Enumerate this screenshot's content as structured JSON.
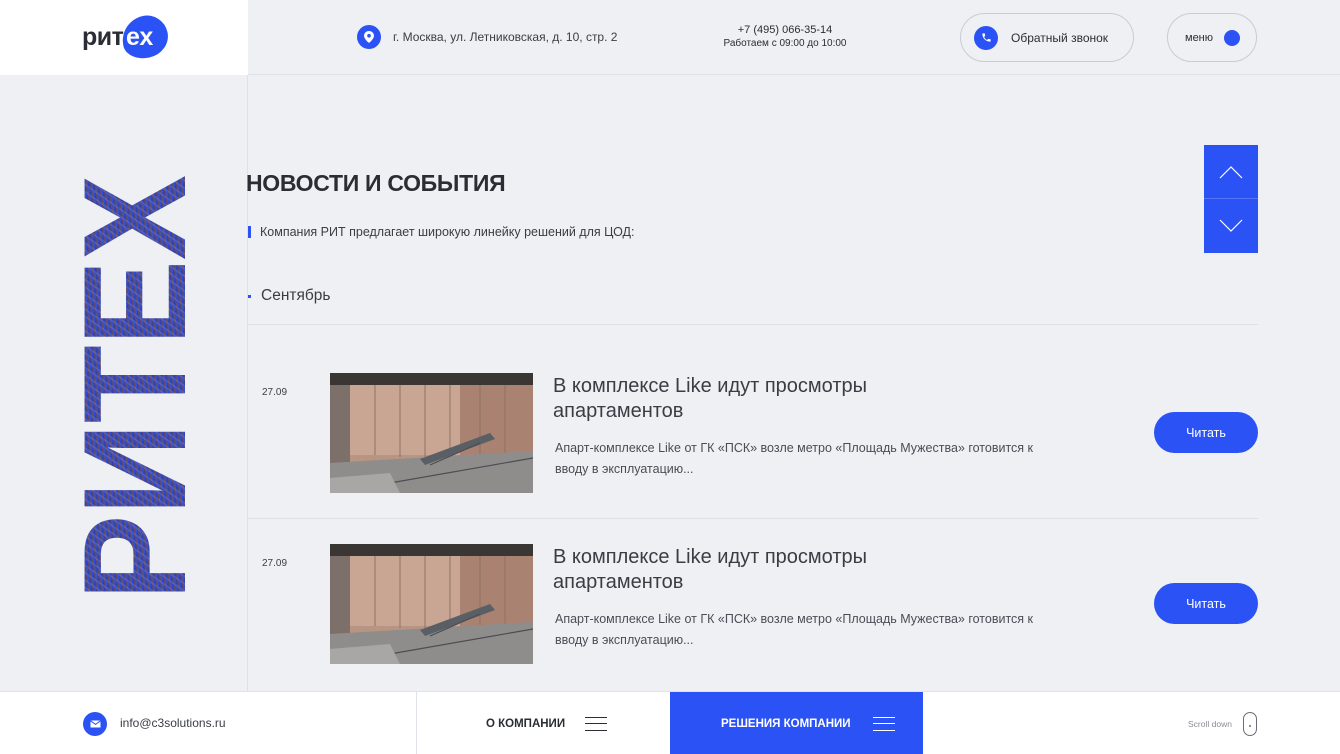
{
  "header": {
    "logo": {
      "left": "рит",
      "right": "ex"
    },
    "address": "г. Москва, ул. Летниковская, д. 10, стр. 2",
    "phone": "+7 (495) 066-35-14",
    "hours": "Работаем с 09:00 до 10:00",
    "callback_label": "Обратный звонок",
    "menu_label": "меню"
  },
  "brand_vertical": "РИТЕХ",
  "main": {
    "title": "НОВОСТИ И СОБЫТИЯ",
    "lead": "Компания РИТ предлагает широкую линейку решений для ЦОД:",
    "month": "Сентябрь",
    "news": [
      {
        "date": "27.09",
        "title": "В комплексе Like идут просмотры апартаментов",
        "description": "Апарт-комплексе Like от ГК «ПСК» возле метро «Площадь Мужества» готовится к вводу в эксплуатацию...",
        "button": "Читать"
      },
      {
        "date": "27.09",
        "title": "В комплексе Like идут просмотры апартаментов",
        "description": "Апарт-комплексе Like от ГК «ПСК» возле метро «Площадь Мужества» готовится к вводу в эксплуатацию...",
        "button": "Читать"
      }
    ]
  },
  "footer": {
    "email": "info@c3solutions.ru",
    "about_label": "О КОМПАНИИ",
    "solutions_label": "РЕШЕНИЯ КОМПАНИИ",
    "scroll_hint": "Scroll down"
  },
  "colors": {
    "accent": "#2a52f5",
    "background": "#eef0f4",
    "text": "#2a2d34"
  }
}
